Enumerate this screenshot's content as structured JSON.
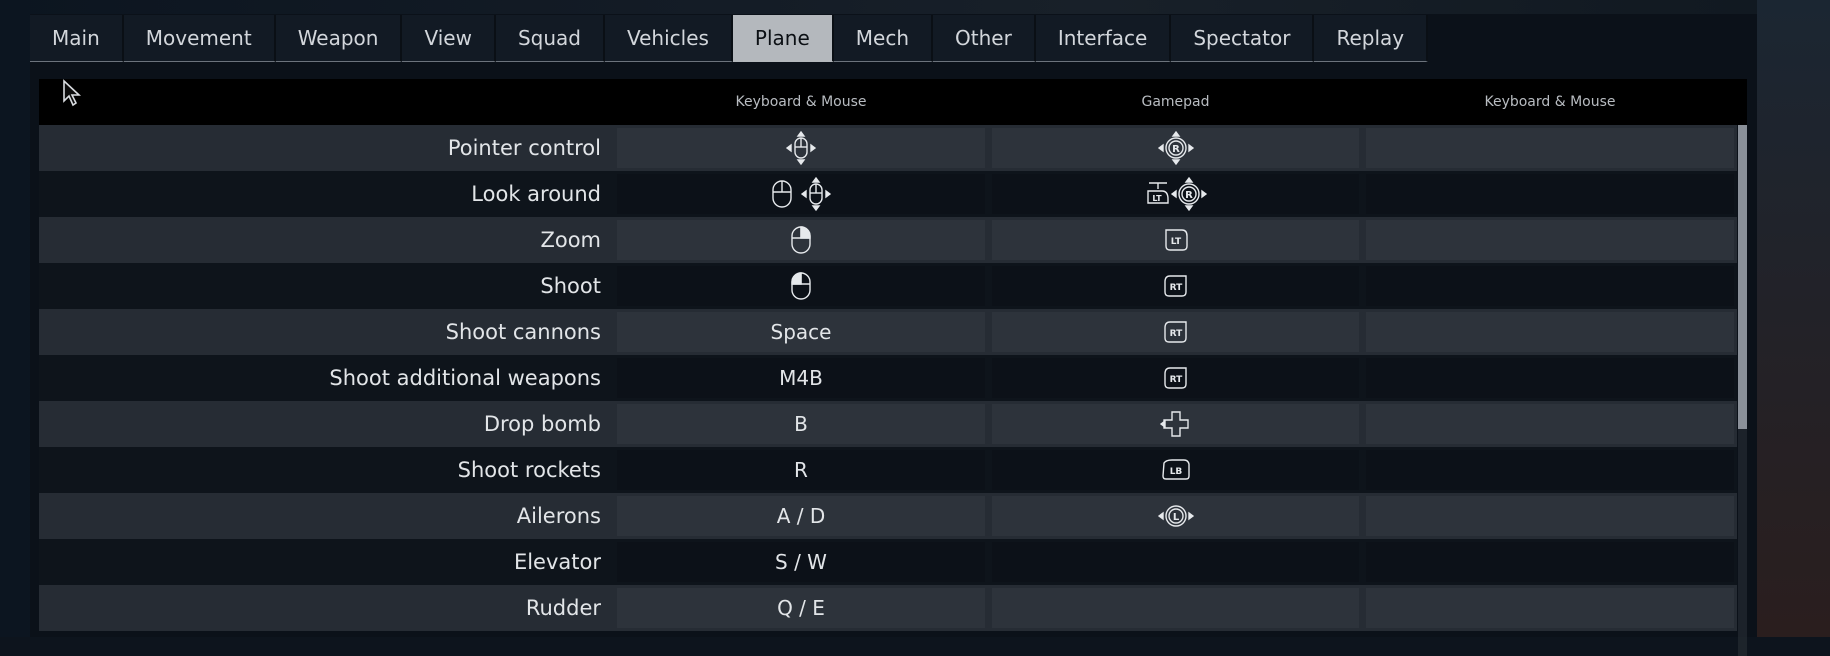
{
  "tabs": [
    {
      "label": "Main"
    },
    {
      "label": "Movement"
    },
    {
      "label": "Weapon"
    },
    {
      "label": "View"
    },
    {
      "label": "Squad"
    },
    {
      "label": "Vehicles"
    },
    {
      "label": "Plane",
      "active": true
    },
    {
      "label": "Mech"
    },
    {
      "label": "Other"
    },
    {
      "label": "Interface"
    },
    {
      "label": "Spectator"
    },
    {
      "label": "Replay"
    }
  ],
  "table": {
    "headers": [
      "Keyboard & Mouse",
      "Gamepad",
      "Keyboard & Mouse"
    ],
    "rows": [
      {
        "action": "Pointer control",
        "kbm": "",
        "kbm_icons": [
          "mouse-move-icon"
        ],
        "gamepad_icons": [
          "right-stick-move-icon"
        ],
        "kbm2": ""
      },
      {
        "action": "Look around",
        "kbm": "",
        "kbm_icons": [
          "mouse-icon",
          "mouse-move-icon"
        ],
        "gamepad_icons": [
          "lt-hold-icon",
          "right-stick-move-icon"
        ],
        "kbm2": ""
      },
      {
        "action": "Zoom",
        "kbm": "",
        "kbm_icons": [
          "mouse-right-button-icon"
        ],
        "gamepad_icons": [
          "lt-trigger-icon"
        ],
        "kbm2": ""
      },
      {
        "action": "Shoot",
        "kbm": "",
        "kbm_icons": [
          "mouse-left-button-icon"
        ],
        "gamepad_icons": [
          "rt-trigger-icon"
        ],
        "kbm2": ""
      },
      {
        "action": "Shoot cannons",
        "kbm": "Space",
        "kbm_icons": [],
        "gamepad_icons": [
          "rt-trigger-icon"
        ],
        "kbm2": ""
      },
      {
        "action": "Shoot additional weapons",
        "kbm": "M4B",
        "kbm_icons": [],
        "gamepad_icons": [
          "rt-trigger-icon"
        ],
        "kbm2": ""
      },
      {
        "action": "Drop bomb",
        "kbm": "B",
        "kbm_icons": [],
        "gamepad_icons": [
          "dpad-left-icon"
        ],
        "kbm2": ""
      },
      {
        "action": "Shoot rockets",
        "kbm": "R",
        "kbm_icons": [],
        "gamepad_icons": [
          "lb-bumper-icon"
        ],
        "kbm2": ""
      },
      {
        "action": "Ailerons",
        "kbm": "A / D",
        "kbm_icons": [],
        "gamepad_icons": [
          "left-stick-horizontal-icon"
        ],
        "kbm2": ""
      },
      {
        "action": "Elevator",
        "kbm": "S / W",
        "kbm_icons": [],
        "gamepad_icons": [],
        "kbm2": ""
      },
      {
        "action": "Rudder",
        "kbm": "Q / E",
        "kbm_icons": [],
        "gamepad_icons": [],
        "kbm2": ""
      }
    ]
  },
  "colors": {
    "active_tab_bg": "#b4b8bd",
    "header_bg": "#000000",
    "scroll_thumb": "#8a9099"
  }
}
